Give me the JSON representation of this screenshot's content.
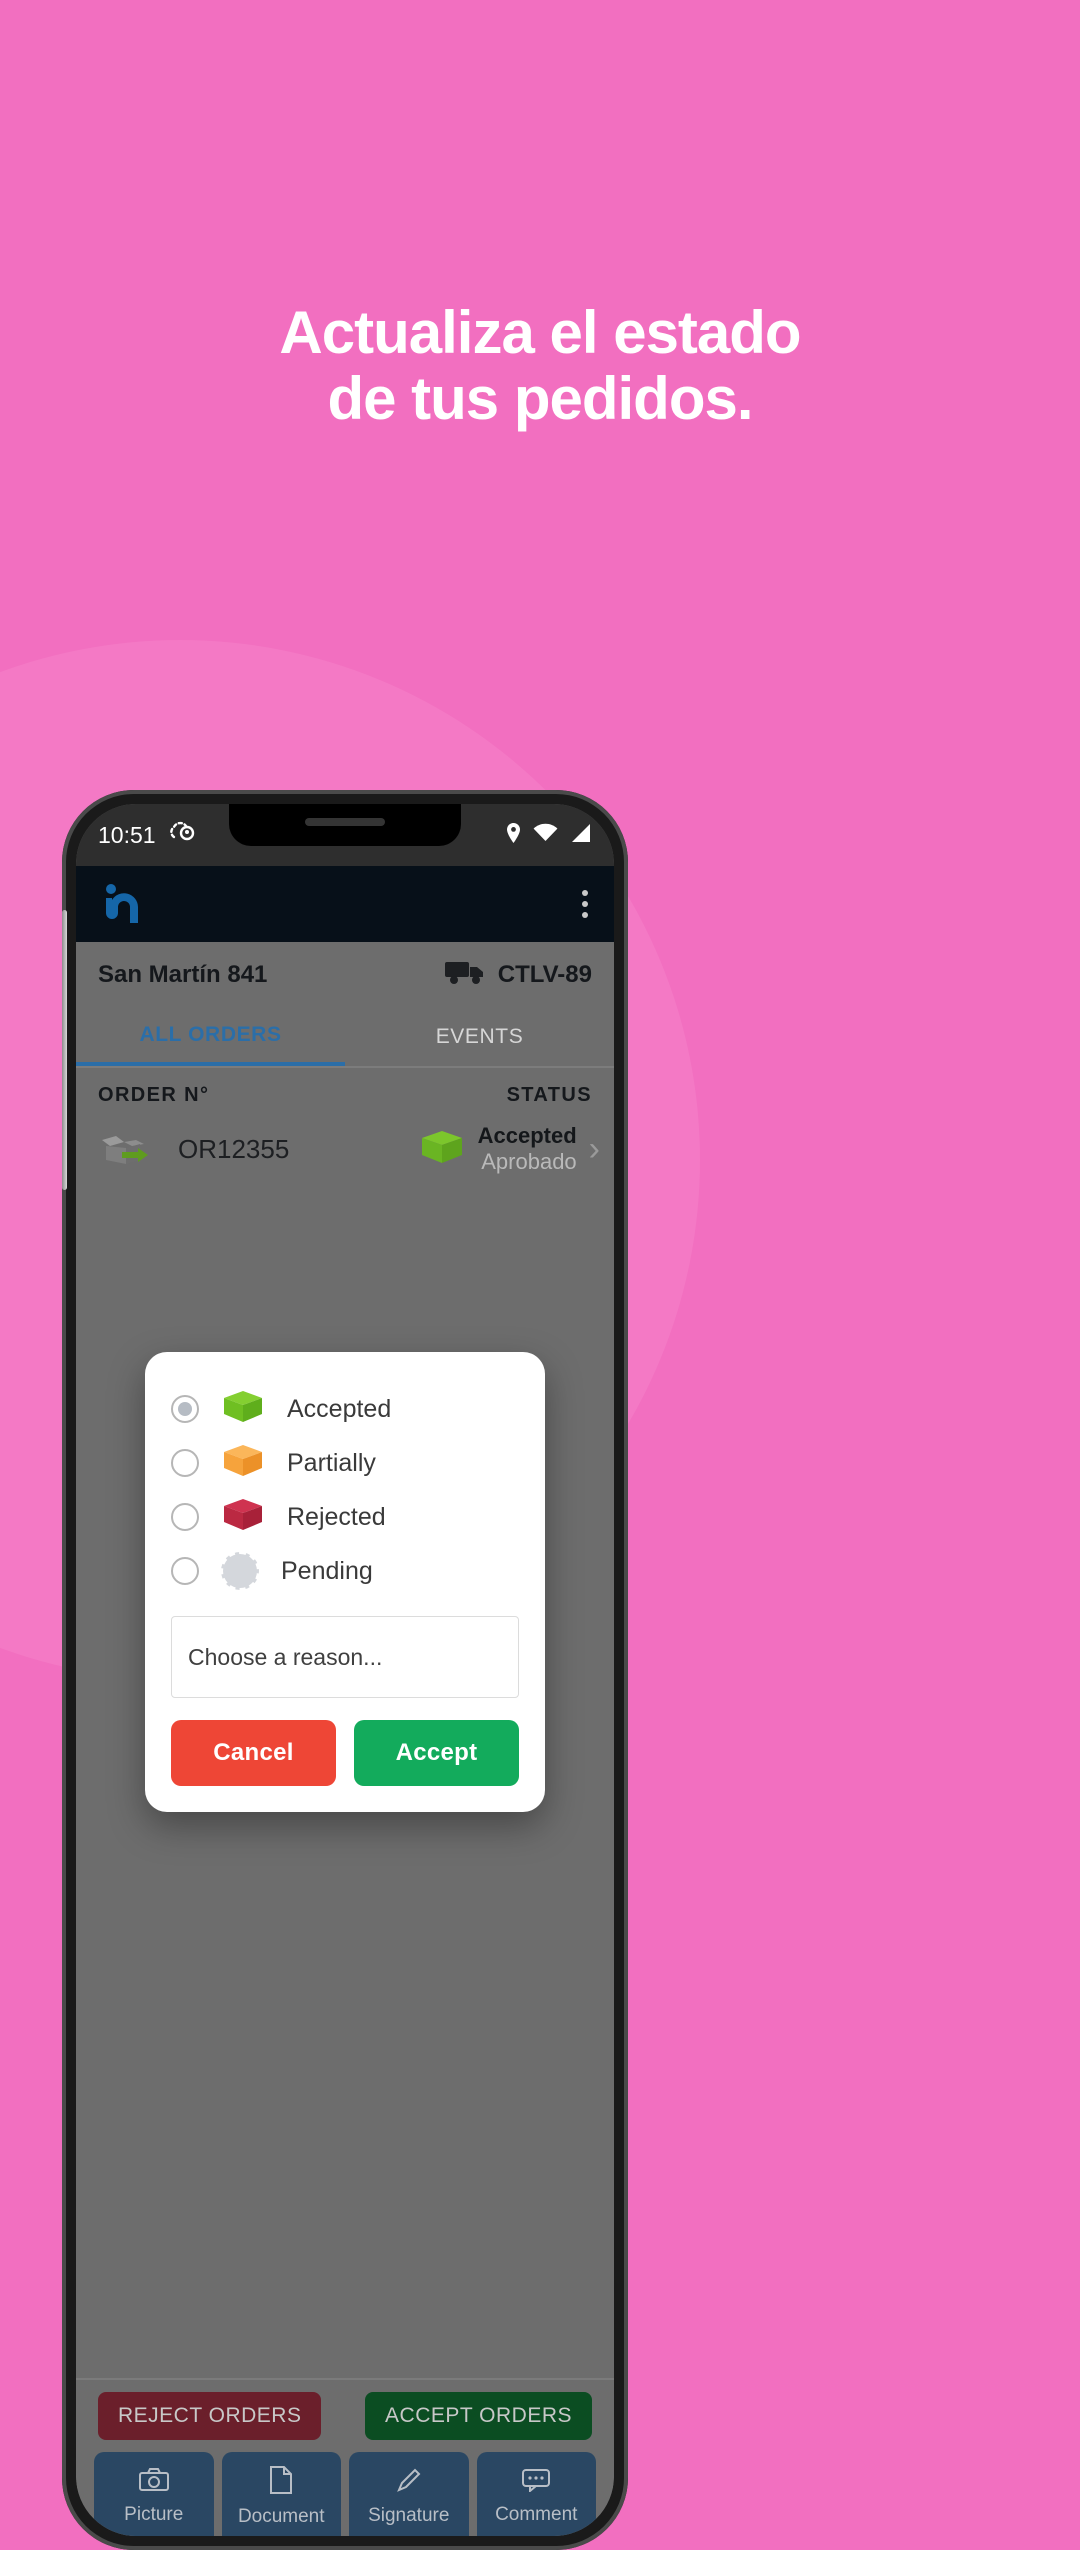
{
  "promo": {
    "headline_line1": "Actualiza el estado",
    "headline_line2": "de tus pedidos.",
    "background_color": "#f26fc0",
    "headline_color": "#ffffff"
  },
  "status_bar": {
    "time": "10:51",
    "notification_icon": "cloud-location-icon",
    "location_icon": "location-pin-icon",
    "wifi_icon": "wifi-icon",
    "signal_icon": "cell-signal-icon"
  },
  "app_bar": {
    "logo": "in-logo-icon",
    "logo_color": "#1566a8",
    "overflow_icon": "kebab-menu-icon",
    "background_color": "#071019"
  },
  "header": {
    "location_name": "San Martín 841",
    "truck_icon": "truck-icon",
    "vehicle_id": "CTLV-89"
  },
  "tabs": [
    {
      "label": "ALL ORDERS",
      "active": true
    },
    {
      "label": "EVENTS",
      "active": false
    }
  ],
  "table": {
    "col_order": "ORDER N°",
    "col_status": "STATUS",
    "rows": [
      {
        "icon": "open-box-green-arrow-icon",
        "order_no": "OR12355",
        "status_icon": "box-green-icon",
        "status": "Accepted",
        "status_sub": "Aprobado",
        "chevron": "chevron-right-icon"
      }
    ]
  },
  "order_actions": {
    "reject_label": "REJECT ORDERS",
    "reject_color": "#6b1f2b",
    "accept_label": "ACCEPT ORDERS",
    "accept_color": "#0b4d22"
  },
  "tool_bar": [
    {
      "label": "Picture",
      "icon": "camera-icon"
    },
    {
      "label": "Document",
      "icon": "document-icon"
    },
    {
      "label": "Signature",
      "icon": "pencil-icon"
    },
    {
      "label": "Comment",
      "icon": "comment-icon"
    }
  ],
  "dialog": {
    "options": [
      {
        "label": "Accepted",
        "icon": "box-green-icon",
        "color": "#6cc024",
        "selected": true
      },
      {
        "label": "Partially",
        "icon": "box-orange-icon",
        "color": "#f7a53b",
        "selected": false
      },
      {
        "label": "Rejected",
        "icon": "box-red-icon",
        "color": "#bf2a45",
        "selected": false
      },
      {
        "label": "Pending",
        "icon": "pending-circle-icon",
        "color": "#d4d7dc",
        "selected": false
      }
    ],
    "reason_placeholder": "Choose a reason...",
    "cancel_label": "Cancel",
    "accept_label": "Accept",
    "cancel_color": "#ee4636",
    "accept_color": "#13ab5c"
  }
}
